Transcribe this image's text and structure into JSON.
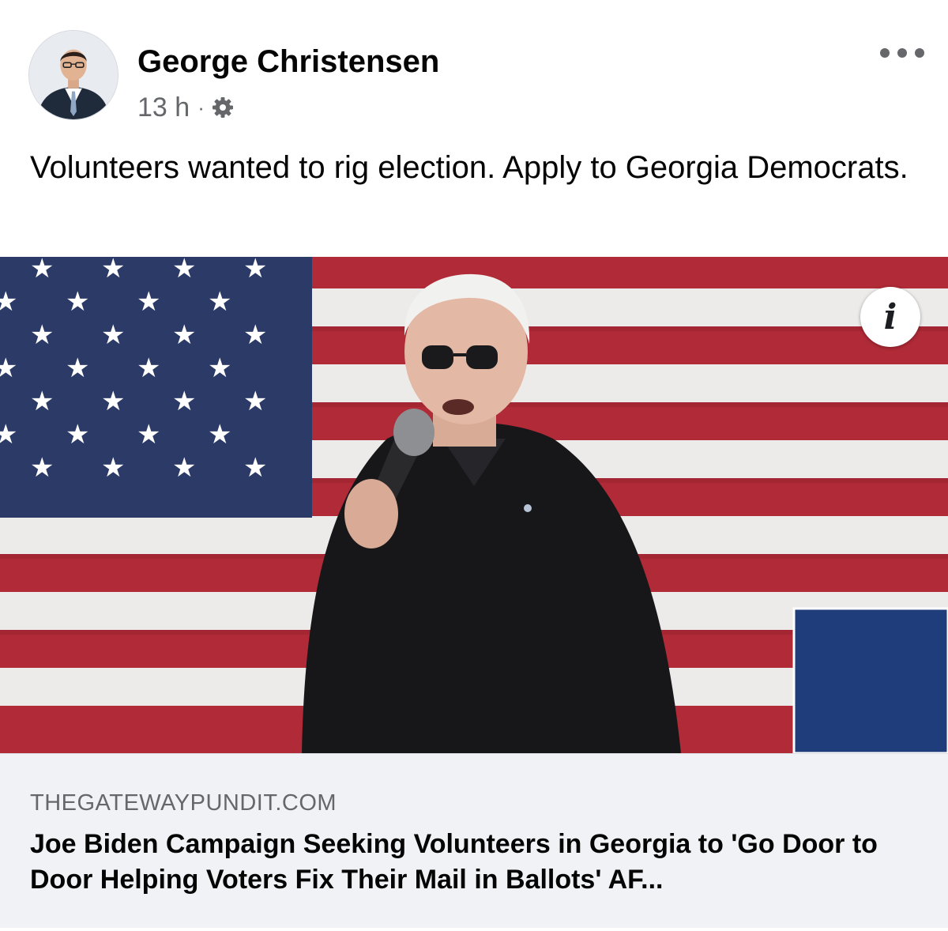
{
  "post": {
    "author": "George Christensen",
    "timestamp": "13 h",
    "separator": "·",
    "audience_icon": "gear-icon",
    "more_icon": "more-options-icon",
    "caption": "Volunteers wanted to rig election. Apply to Georgia Democrats."
  },
  "link_preview": {
    "info_label": "i",
    "domain": "THEGATEWAYPUNDIT.COM",
    "headline": "Joe Biden Campaign Seeking Volunteers in Georgia to 'Go Door to Door Helping Voters Fix Their Mail in Ballots' AF..."
  },
  "colors": {
    "name_text": "#050505",
    "meta_text": "#65676b",
    "card_background": "#f0f2f5",
    "flag_red": "#b02a37",
    "flag_blue": "#2b3a67"
  }
}
